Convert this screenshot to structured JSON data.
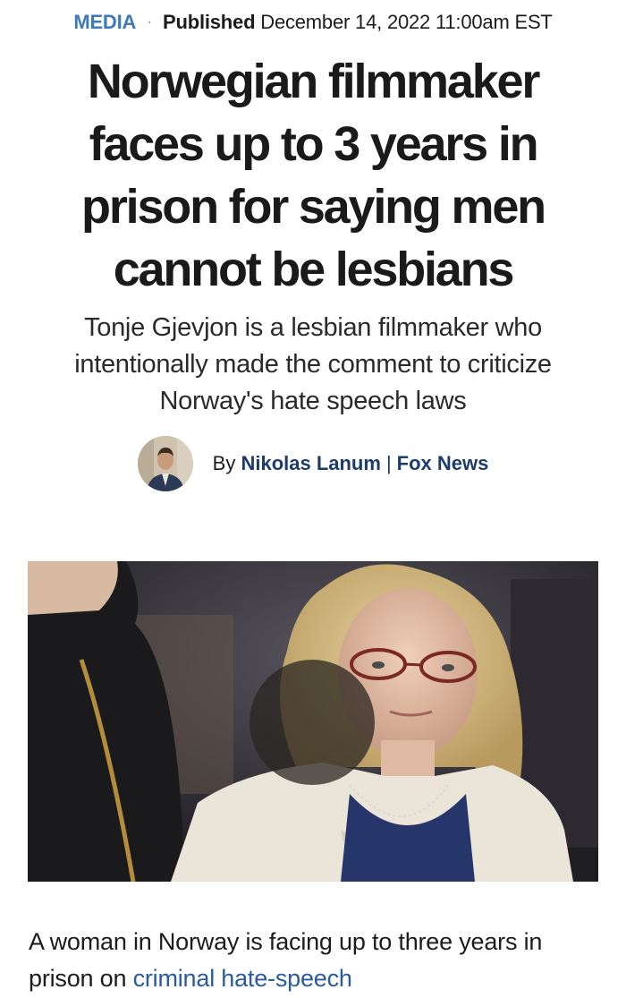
{
  "article": {
    "category": "MEDIA",
    "separator": "·",
    "published_label": "Published",
    "published_date": "December 14, 2022 11:00am EST",
    "headline": "Norwegian filmmaker faces up to 3 years in prison for saying men cannot be lesbians",
    "subheadline": "Tonje Gjevjon is a lesbian filmmaker who intentionally made the comment to criticize Norway's hate speech laws",
    "byline": {
      "prefix": "By",
      "author": "Nikolas Lanum",
      "separator": "|",
      "outlet": "Fox News"
    },
    "body": {
      "text_before_link": "A woman in Norway is facing up to three years in prison on ",
      "link_text": "criminal hate-speech"
    }
  },
  "colors": {
    "category": "#3e78b8",
    "byline_link": "#1d3c6e",
    "body_link": "#2a5aa0",
    "headline": "#1a1a1a"
  },
  "icons": {
    "avatar": "author-avatar",
    "hero": "article-hero-photo"
  }
}
